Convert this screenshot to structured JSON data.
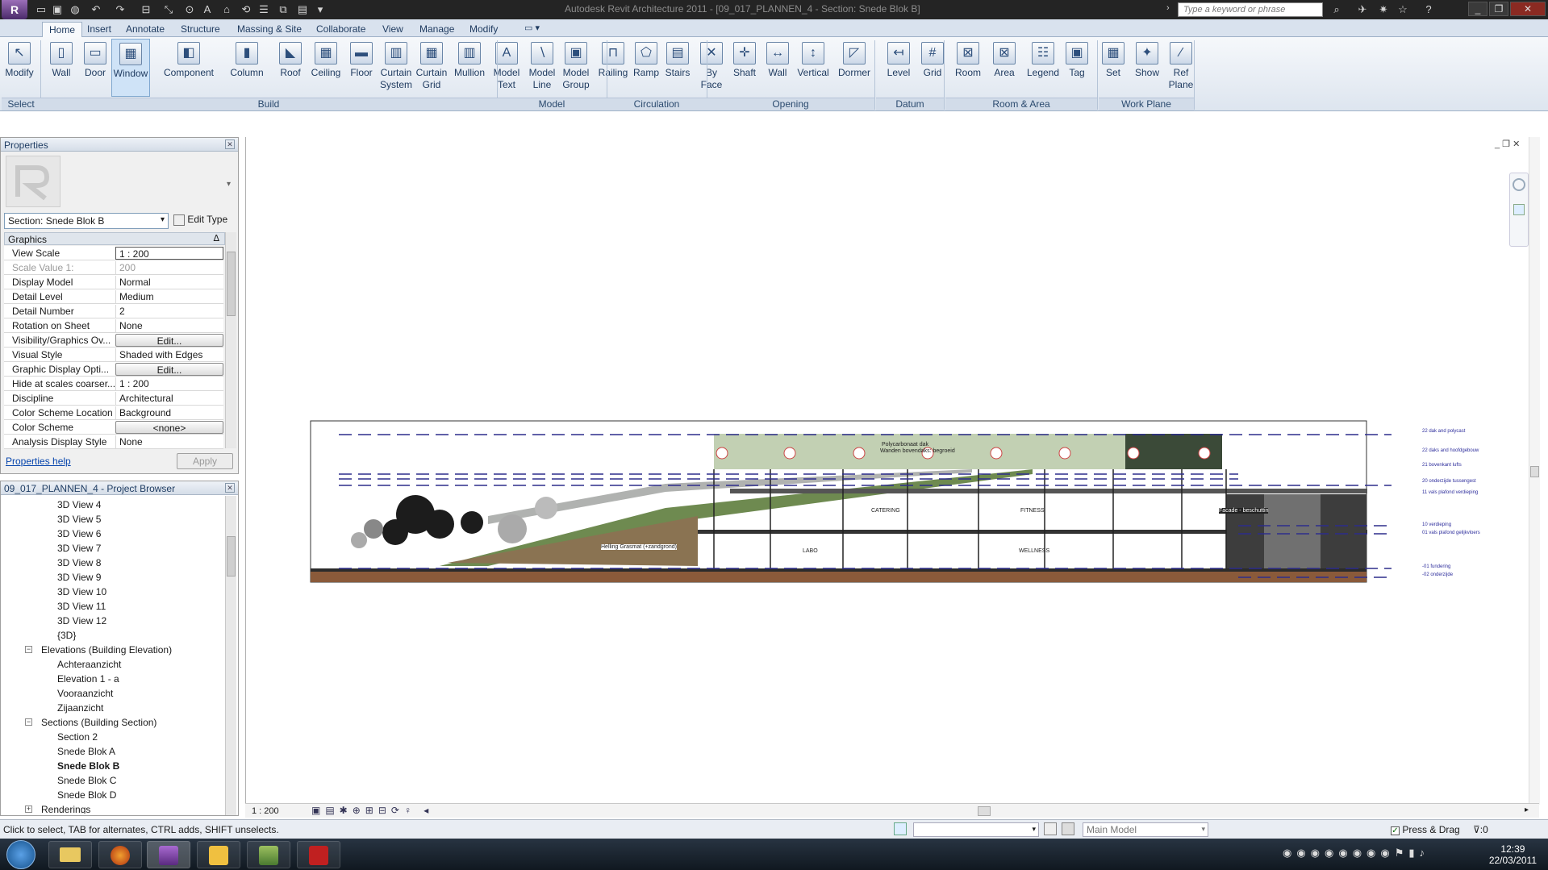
{
  "window": {
    "title": "Autodesk Revit Architecture 2011 - [09_017_PLANNEN_4 - Section: Snede Blok B]",
    "search_placeholder": "Type a keyword or phrase"
  },
  "menu_tabs": [
    "Home",
    "Insert",
    "Annotate",
    "Structure",
    "Massing & Site",
    "Collaborate",
    "View",
    "Manage",
    "Modify"
  ],
  "ribbon": {
    "buttons": [
      {
        "l1": "Modify",
        "l2": ""
      },
      {
        "l1": "Wall",
        "l2": ""
      },
      {
        "l1": "Door",
        "l2": ""
      },
      {
        "l1": "Window",
        "l2": ""
      },
      {
        "l1": "Component",
        "l2": ""
      },
      {
        "l1": "Column",
        "l2": ""
      },
      {
        "l1": "Roof",
        "l2": ""
      },
      {
        "l1": "Ceiling",
        "l2": ""
      },
      {
        "l1": "Floor",
        "l2": ""
      },
      {
        "l1": "Curtain",
        "l2": "System"
      },
      {
        "l1": "Curtain",
        "l2": "Grid"
      },
      {
        "l1": "Mullion",
        "l2": ""
      },
      {
        "l1": "Model",
        "l2": "Text"
      },
      {
        "l1": "Model",
        "l2": "Line"
      },
      {
        "l1": "Model",
        "l2": "Group"
      },
      {
        "l1": "Railing",
        "l2": ""
      },
      {
        "l1": "Ramp",
        "l2": ""
      },
      {
        "l1": "Stairs",
        "l2": ""
      },
      {
        "l1": "By",
        "l2": "Face"
      },
      {
        "l1": "Shaft",
        "l2": ""
      },
      {
        "l1": "Wall",
        "l2": ""
      },
      {
        "l1": "Vertical",
        "l2": ""
      },
      {
        "l1": "Dormer",
        "l2": ""
      },
      {
        "l1": "Level",
        "l2": ""
      },
      {
        "l1": "Grid",
        "l2": ""
      },
      {
        "l1": "Room",
        "l2": ""
      },
      {
        "l1": "Area",
        "l2": ""
      },
      {
        "l1": "Legend",
        "l2": ""
      },
      {
        "l1": "Tag",
        "l2": ""
      },
      {
        "l1": "Set",
        "l2": ""
      },
      {
        "l1": "Show",
        "l2": ""
      },
      {
        "l1": "Ref",
        "l2": "Plane"
      }
    ],
    "groups": [
      "Select",
      "Build",
      "Model",
      "Circulation",
      "Opening",
      "Datum",
      "Room & Area",
      "Work Plane"
    ]
  },
  "properties": {
    "title": "Properties",
    "type_selector": "Section: Snede Blok B",
    "edit_type": "Edit Type",
    "group": "Graphics",
    "rows": [
      {
        "k": "View Scale",
        "v": "1 : 200"
      },
      {
        "k": "Scale Value    1:",
        "v": "200"
      },
      {
        "k": "Display Model",
        "v": "Normal"
      },
      {
        "k": "Detail Level",
        "v": "Medium"
      },
      {
        "k": "Detail Number",
        "v": "2"
      },
      {
        "k": "Rotation on Sheet",
        "v": "None"
      },
      {
        "k": "Visibility/Graphics Ov...",
        "v": "Edit..."
      },
      {
        "k": "Visual Style",
        "v": "Shaded with Edges"
      },
      {
        "k": "Graphic Display Opti...",
        "v": "Edit..."
      },
      {
        "k": "Hide at scales coarser...",
        "v": "1 : 200"
      },
      {
        "k": "Discipline",
        "v": "Architectural"
      },
      {
        "k": "Color Scheme Location",
        "v": "Background"
      },
      {
        "k": "Color Scheme",
        "v": "<none>"
      },
      {
        "k": "Analysis Display Style",
        "v": "None"
      }
    ],
    "help": "Properties help",
    "apply": "Apply"
  },
  "browser": {
    "title": "09_017_PLANNEN_4 - Project Browser",
    "items": [
      {
        "t": "3D View 4",
        "lvl": 2
      },
      {
        "t": "3D View 5",
        "lvl": 2
      },
      {
        "t": "3D View 6",
        "lvl": 2
      },
      {
        "t": "3D View 7",
        "lvl": 2
      },
      {
        "t": "3D View 8",
        "lvl": 2
      },
      {
        "t": "3D View 9",
        "lvl": 2
      },
      {
        "t": "3D View 10",
        "lvl": 2
      },
      {
        "t": "3D View 11",
        "lvl": 2
      },
      {
        "t": "3D View 12",
        "lvl": 2
      },
      {
        "t": "{3D}",
        "lvl": 2
      },
      {
        "t": "Elevations (Building Elevation)",
        "lvl": 1,
        "tw": "−"
      },
      {
        "t": "Achteraanzicht",
        "lvl": 2
      },
      {
        "t": "Elevation 1 - a",
        "lvl": 2
      },
      {
        "t": "Vooraanzicht",
        "lvl": 2
      },
      {
        "t": "Zijaanzicht",
        "lvl": 2
      },
      {
        "t": "Sections (Building Section)",
        "lvl": 1,
        "tw": "−"
      },
      {
        "t": "Section 2",
        "lvl": 2
      },
      {
        "t": "Snede Blok A",
        "lvl": 2
      },
      {
        "t": "Snede Blok B",
        "lvl": 2,
        "bold": true
      },
      {
        "t": "Snede Blok C",
        "lvl": 2
      },
      {
        "t": "Snede Blok D",
        "lvl": 2
      },
      {
        "t": "Renderings",
        "lvl": 1,
        "tw": "+"
      }
    ]
  },
  "drawing": {
    "roof_text_1": "Polycarbonaat dak",
    "roof_text_2": "Wanden bovendaks: begroeid",
    "rooms": [
      "CATERING",
      "FITNESS",
      "LABO",
      "WELLNESS"
    ],
    "helling": "Helling Grasmat (+zandgrond)",
    "facade_note": "Facade - beschuttin",
    "level_labels": [
      "22 dak and polycast",
      "22 daks and hoofdgebouw",
      "21 bovenkant lufts",
      "20 onderzijde tussengest",
      "11 vals plafond verdieping",
      "10 verdieping",
      "01 vals plafond gelijkvloers",
      "-01 fundering",
      "-02 onderzijde"
    ]
  },
  "viewbar": {
    "scale": "1 : 200"
  },
  "status": {
    "hint": "Click to select, TAB for alternates, CTRL adds, SHIFT unselects.",
    "model": "Main Model",
    "press_drag": "Press & Drag",
    "filter": ":0"
  },
  "clock": {
    "time": "12:39",
    "date": "22/03/2011"
  },
  "colors": {
    "accent": "#2d2d8c",
    "ribbon": "#dde5ef",
    "titlebar": "#242424"
  }
}
